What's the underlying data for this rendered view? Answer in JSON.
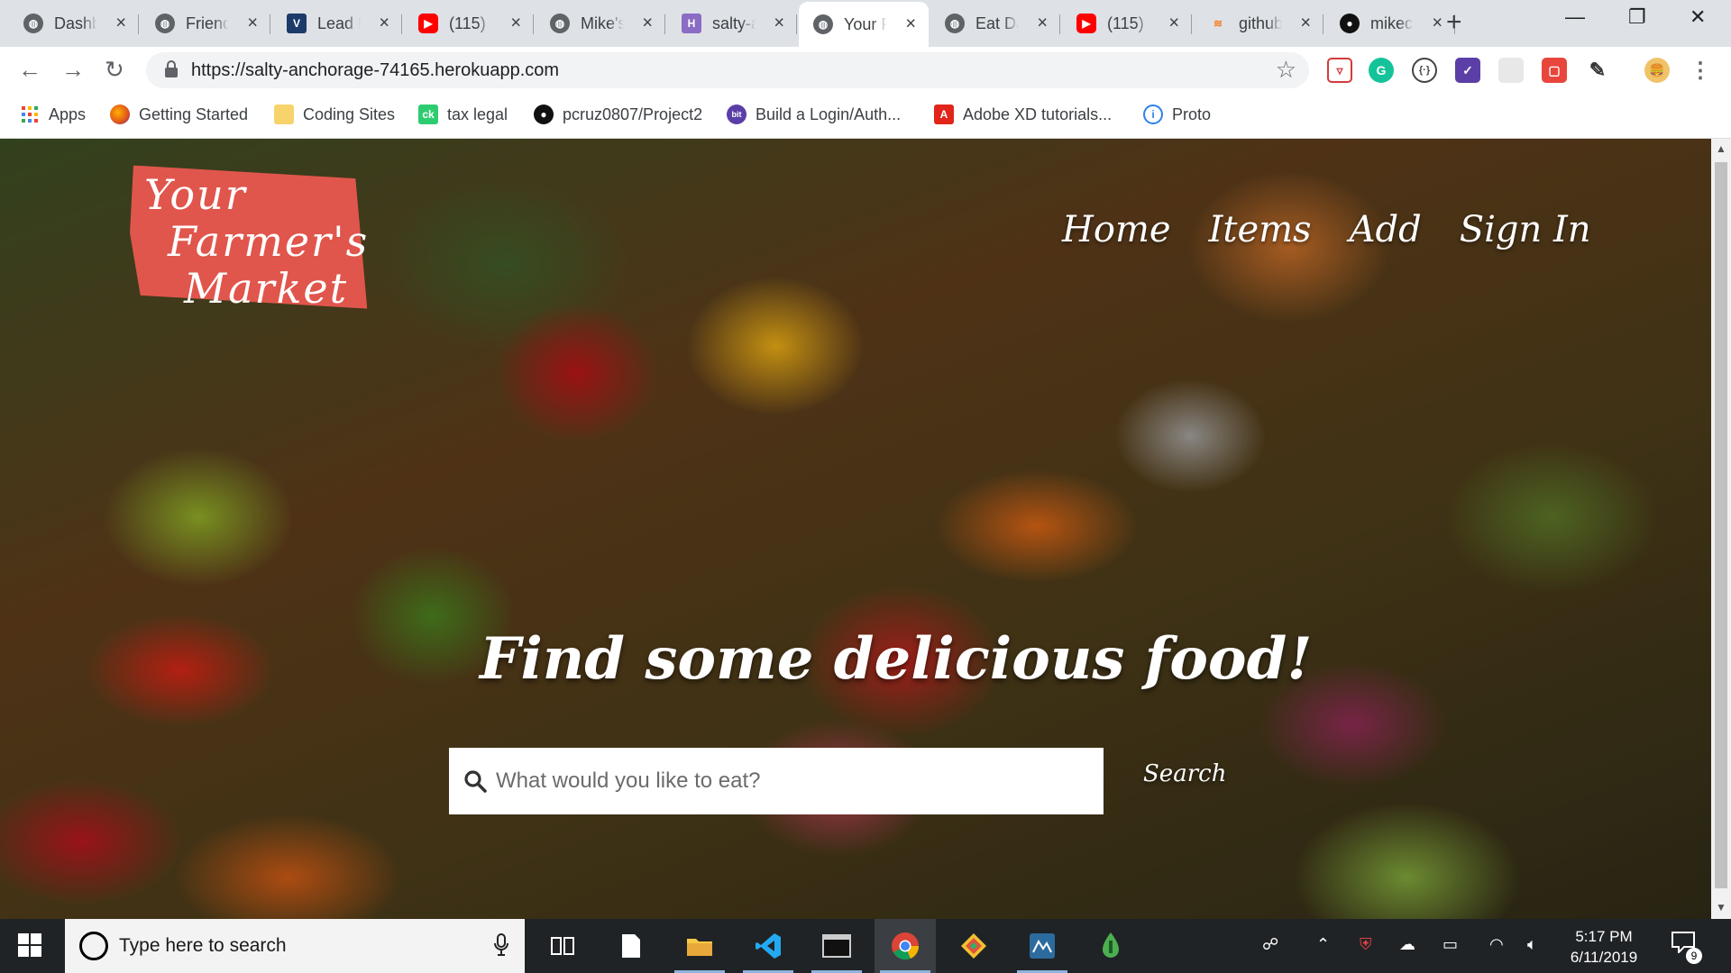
{
  "browser": {
    "tabs": [
      {
        "title": "Dashboard",
        "icon": "globe-icon"
      },
      {
        "title": "Friends",
        "icon": "globe-icon"
      },
      {
        "title": "Lead Engineer",
        "icon": "v-logo-icon"
      },
      {
        "title": "(115)",
        "icon": "youtube-icon"
      },
      {
        "title": "Mike's",
        "icon": "globe-icon"
      },
      {
        "title": "salty-anchorage",
        "icon": "heroku-icon"
      },
      {
        "title": "Your Farmer's Market",
        "icon": "globe-icon"
      },
      {
        "title": "Eat Da Burger",
        "icon": "globe-icon"
      },
      {
        "title": "(115)",
        "icon": "youtube-icon"
      },
      {
        "title": "github",
        "icon": "stackoverflow-icon"
      },
      {
        "title": "mikec",
        "icon": "github-icon"
      }
    ],
    "active_tab_index": 6,
    "url": "https://salty-anchorage-74165.herokuapp.com",
    "bookmarks": [
      {
        "label": "Apps",
        "icon": "apps-grid-icon"
      },
      {
        "label": "Getting Started",
        "icon": "firefox-icon"
      },
      {
        "label": "Coding Sites",
        "icon": "folder-icon"
      },
      {
        "label": "tax legal",
        "icon": "ck-icon"
      },
      {
        "label": "pcruz0807/Project2",
        "icon": "github-icon"
      },
      {
        "label": "Build a Login/Auth...",
        "icon": "bit-icon"
      },
      {
        "label": "Adobe XD tutorials...",
        "icon": "adobe-icon"
      },
      {
        "label": "Proto",
        "icon": "proto-icon"
      }
    ]
  },
  "page": {
    "logo": {
      "line1": "Your",
      "line2": "Farmer's",
      "line3": "Market"
    },
    "nav": {
      "home": "Home",
      "items": "Items",
      "add": "Add",
      "sign_in": "Sign In"
    },
    "headline": "Find some delicious food!",
    "search": {
      "placeholder": "What would you like to eat?",
      "value": "",
      "button": "Search"
    }
  },
  "taskbar": {
    "search_placeholder": "Type here to search",
    "apps": [
      "task-view-icon",
      "file-icon",
      "file-explorer-icon",
      "vscode-icon",
      "terminal-icon",
      "chrome-icon",
      "git-kraken-icon",
      "mysql-workbench-icon",
      "robo3t-icon"
    ],
    "time": "5:17 PM",
    "date": "6/11/2019",
    "notification_count": "9"
  },
  "colors": {
    "logo_bg": "#e0564c",
    "tab_strip": "#dee1e6",
    "taskbar": "#202326"
  }
}
